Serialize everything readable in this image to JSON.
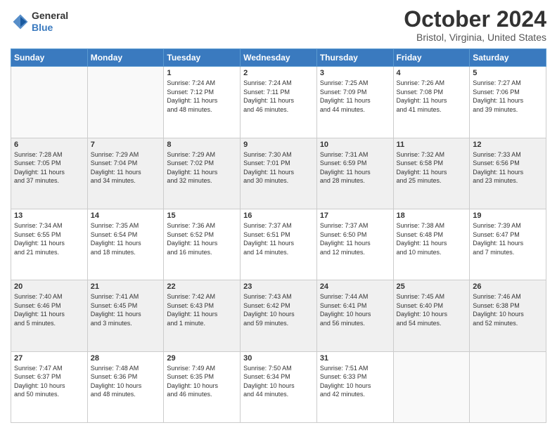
{
  "header": {
    "logo_line1": "General",
    "logo_line2": "Blue",
    "month": "October 2024",
    "location": "Bristol, Virginia, United States"
  },
  "weekdays": [
    "Sunday",
    "Monday",
    "Tuesday",
    "Wednesday",
    "Thursday",
    "Friday",
    "Saturday"
  ],
  "weeks": [
    [
      {
        "day": "",
        "info": ""
      },
      {
        "day": "",
        "info": ""
      },
      {
        "day": "1",
        "info": "Sunrise: 7:24 AM\nSunset: 7:12 PM\nDaylight: 11 hours\nand 48 minutes."
      },
      {
        "day": "2",
        "info": "Sunrise: 7:24 AM\nSunset: 7:11 PM\nDaylight: 11 hours\nand 46 minutes."
      },
      {
        "day": "3",
        "info": "Sunrise: 7:25 AM\nSunset: 7:09 PM\nDaylight: 11 hours\nand 44 minutes."
      },
      {
        "day": "4",
        "info": "Sunrise: 7:26 AM\nSunset: 7:08 PM\nDaylight: 11 hours\nand 41 minutes."
      },
      {
        "day": "5",
        "info": "Sunrise: 7:27 AM\nSunset: 7:06 PM\nDaylight: 11 hours\nand 39 minutes."
      }
    ],
    [
      {
        "day": "6",
        "info": "Sunrise: 7:28 AM\nSunset: 7:05 PM\nDaylight: 11 hours\nand 37 minutes."
      },
      {
        "day": "7",
        "info": "Sunrise: 7:29 AM\nSunset: 7:04 PM\nDaylight: 11 hours\nand 34 minutes."
      },
      {
        "day": "8",
        "info": "Sunrise: 7:29 AM\nSunset: 7:02 PM\nDaylight: 11 hours\nand 32 minutes."
      },
      {
        "day": "9",
        "info": "Sunrise: 7:30 AM\nSunset: 7:01 PM\nDaylight: 11 hours\nand 30 minutes."
      },
      {
        "day": "10",
        "info": "Sunrise: 7:31 AM\nSunset: 6:59 PM\nDaylight: 11 hours\nand 28 minutes."
      },
      {
        "day": "11",
        "info": "Sunrise: 7:32 AM\nSunset: 6:58 PM\nDaylight: 11 hours\nand 25 minutes."
      },
      {
        "day": "12",
        "info": "Sunrise: 7:33 AM\nSunset: 6:56 PM\nDaylight: 11 hours\nand 23 minutes."
      }
    ],
    [
      {
        "day": "13",
        "info": "Sunrise: 7:34 AM\nSunset: 6:55 PM\nDaylight: 11 hours\nand 21 minutes."
      },
      {
        "day": "14",
        "info": "Sunrise: 7:35 AM\nSunset: 6:54 PM\nDaylight: 11 hours\nand 18 minutes."
      },
      {
        "day": "15",
        "info": "Sunrise: 7:36 AM\nSunset: 6:52 PM\nDaylight: 11 hours\nand 16 minutes."
      },
      {
        "day": "16",
        "info": "Sunrise: 7:37 AM\nSunset: 6:51 PM\nDaylight: 11 hours\nand 14 minutes."
      },
      {
        "day": "17",
        "info": "Sunrise: 7:37 AM\nSunset: 6:50 PM\nDaylight: 11 hours\nand 12 minutes."
      },
      {
        "day": "18",
        "info": "Sunrise: 7:38 AM\nSunset: 6:48 PM\nDaylight: 11 hours\nand 10 minutes."
      },
      {
        "day": "19",
        "info": "Sunrise: 7:39 AM\nSunset: 6:47 PM\nDaylight: 11 hours\nand 7 minutes."
      }
    ],
    [
      {
        "day": "20",
        "info": "Sunrise: 7:40 AM\nSunset: 6:46 PM\nDaylight: 11 hours\nand 5 minutes."
      },
      {
        "day": "21",
        "info": "Sunrise: 7:41 AM\nSunset: 6:45 PM\nDaylight: 11 hours\nand 3 minutes."
      },
      {
        "day": "22",
        "info": "Sunrise: 7:42 AM\nSunset: 6:43 PM\nDaylight: 11 hours\nand 1 minute."
      },
      {
        "day": "23",
        "info": "Sunrise: 7:43 AM\nSunset: 6:42 PM\nDaylight: 10 hours\nand 59 minutes."
      },
      {
        "day": "24",
        "info": "Sunrise: 7:44 AM\nSunset: 6:41 PM\nDaylight: 10 hours\nand 56 minutes."
      },
      {
        "day": "25",
        "info": "Sunrise: 7:45 AM\nSunset: 6:40 PM\nDaylight: 10 hours\nand 54 minutes."
      },
      {
        "day": "26",
        "info": "Sunrise: 7:46 AM\nSunset: 6:38 PM\nDaylight: 10 hours\nand 52 minutes."
      }
    ],
    [
      {
        "day": "27",
        "info": "Sunrise: 7:47 AM\nSunset: 6:37 PM\nDaylight: 10 hours\nand 50 minutes."
      },
      {
        "day": "28",
        "info": "Sunrise: 7:48 AM\nSunset: 6:36 PM\nDaylight: 10 hours\nand 48 minutes."
      },
      {
        "day": "29",
        "info": "Sunrise: 7:49 AM\nSunset: 6:35 PM\nDaylight: 10 hours\nand 46 minutes."
      },
      {
        "day": "30",
        "info": "Sunrise: 7:50 AM\nSunset: 6:34 PM\nDaylight: 10 hours\nand 44 minutes."
      },
      {
        "day": "31",
        "info": "Sunrise: 7:51 AM\nSunset: 6:33 PM\nDaylight: 10 hours\nand 42 minutes."
      },
      {
        "day": "",
        "info": ""
      },
      {
        "day": "",
        "info": ""
      }
    ]
  ]
}
